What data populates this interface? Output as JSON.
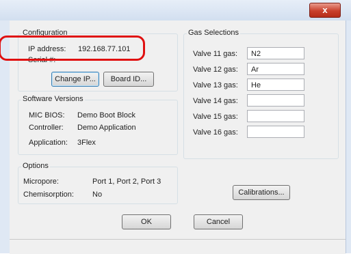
{
  "window": {
    "close_glyph": "x"
  },
  "configuration": {
    "title": "Configuration",
    "ip_label": "IP address:",
    "ip_value": "192.168.77.101",
    "serial_label": "Serial #:",
    "change_ip_button": "Change IP...",
    "board_id_button": "Board ID..."
  },
  "software_versions": {
    "title": "Software Versions",
    "rows": [
      {
        "label": "MIC BIOS:",
        "value": "Demo Boot Block"
      },
      {
        "label": "Controller:",
        "value": "Demo Application"
      },
      {
        "label": "Application:",
        "value": "3Flex"
      }
    ]
  },
  "options": {
    "title": "Options",
    "rows": [
      {
        "label": "Micropore:",
        "value": "Port 1, Port 2, Port 3"
      },
      {
        "label": "Chemisorption:",
        "value": "No"
      }
    ]
  },
  "gas_selections": {
    "title": "Gas Selections",
    "valves": [
      {
        "label": "Valve 11 gas:",
        "value": "N2"
      },
      {
        "label": "Valve 12 gas:",
        "value": "Ar"
      },
      {
        "label": "Valve 13 gas:",
        "value": "He"
      },
      {
        "label": "Valve 14 gas:",
        "value": ""
      },
      {
        "label": "Valve 15 gas:",
        "value": ""
      },
      {
        "label": "Valve 16 gas:",
        "value": ""
      }
    ]
  },
  "buttons": {
    "calibrations": "Calibrations...",
    "ok": "OK",
    "cancel": "Cancel"
  },
  "colors": {
    "highlight": "#e01010",
    "close_button": "#c9402c"
  }
}
